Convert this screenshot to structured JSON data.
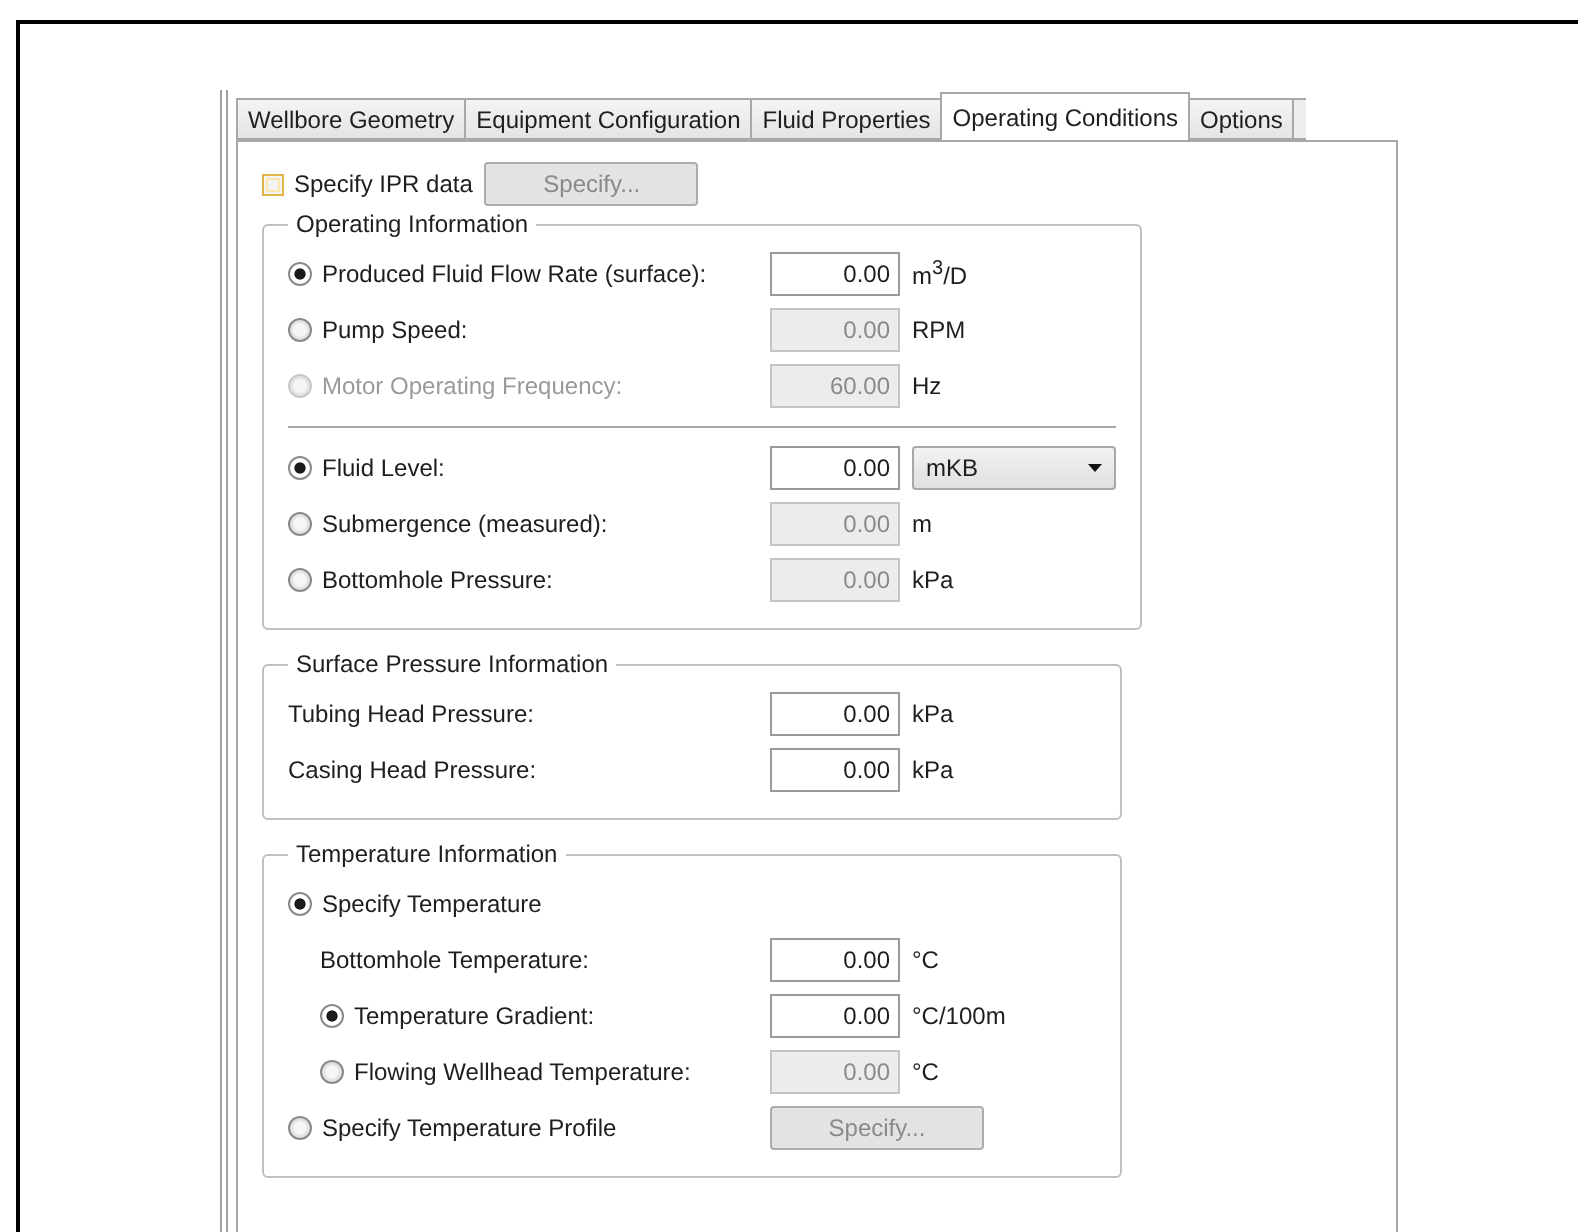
{
  "tabs": [
    {
      "label": "Wellbore Geometry",
      "selected": false
    },
    {
      "label": "Equipment Configuration",
      "selected": false
    },
    {
      "label": "Fluid Properties",
      "selected": false
    },
    {
      "label": "Operating Conditions",
      "selected": true
    },
    {
      "label": "Options",
      "selected": false
    }
  ],
  "ipr": {
    "label": "Specify IPR data",
    "checked": false,
    "button": {
      "label": "Specify...",
      "disabled": true
    }
  },
  "groups": [
    {
      "title": "Operating Information",
      "rows": [
        {
          "kind": "radio",
          "label": "Produced Fluid Flow Rate (surface):",
          "selected": true,
          "disabled": false,
          "input": {
            "value": "0.00",
            "disabled": false
          },
          "unit": "m$^{3}$/D"
        },
        {
          "kind": "radio",
          "label": "Pump Speed:",
          "selected": false,
          "disabled": false,
          "input": {
            "value": "0.00",
            "disabled": true
          },
          "unit": "RPM"
        },
        {
          "kind": "radio",
          "label": "Motor Operating Frequency:",
          "selected": false,
          "disabled": true,
          "input": {
            "value": "60.00",
            "disabled": true
          },
          "unit": "Hz"
        },
        {
          "kind": "divider"
        },
        {
          "kind": "radio",
          "label": "Fluid Level:",
          "selected": true,
          "disabled": false,
          "input": {
            "value": "0.00",
            "disabled": false
          },
          "unit_select": "mKB"
        },
        {
          "kind": "radio",
          "label": "Submergence (measured):",
          "selected": false,
          "disabled": false,
          "input": {
            "value": "0.00",
            "disabled": true
          },
          "unit": "m"
        },
        {
          "kind": "radio",
          "label": "Bottomhole Pressure:",
          "selected": false,
          "disabled": false,
          "input": {
            "value": "0.00",
            "disabled": true
          },
          "unit": "kPa"
        }
      ]
    },
    {
      "title": "Surface Pressure Information",
      "rows": [
        {
          "kind": "label",
          "label": "Tubing Head Pressure:",
          "input": {
            "value": "0.00",
            "disabled": false
          },
          "unit": "kPa"
        },
        {
          "kind": "label",
          "label": "Casing Head Pressure:",
          "input": {
            "value": "0.00",
            "disabled": false
          },
          "unit": "kPa"
        }
      ]
    },
    {
      "title": "Temperature Information",
      "rows": [
        {
          "kind": "radio",
          "label": "Specify Temperature",
          "selected": true,
          "disabled": false,
          "children": [
            {
              "kind": "label",
              "label": "Bottomhole Temperature:",
              "input": {
                "value": "0.00",
                "disabled": false
              },
              "unit": "°C"
            },
            {
              "kind": "radio",
              "label": "Temperature Gradient:",
              "selected": true,
              "disabled": false,
              "input": {
                "value": "0.00",
                "disabled": false
              },
              "unit": "°C/100m"
            },
            {
              "kind": "radio",
              "label": "Flowing Wellhead Temperature:",
              "selected": false,
              "disabled": false,
              "input": {
                "value": "0.00",
                "disabled": true
              },
              "unit": "°C"
            }
          ]
        },
        {
          "kind": "radio",
          "label": "Specify Temperature Profile",
          "selected": false,
          "disabled": false,
          "button": {
            "label": "Specify...",
            "disabled": true
          }
        }
      ]
    }
  ]
}
